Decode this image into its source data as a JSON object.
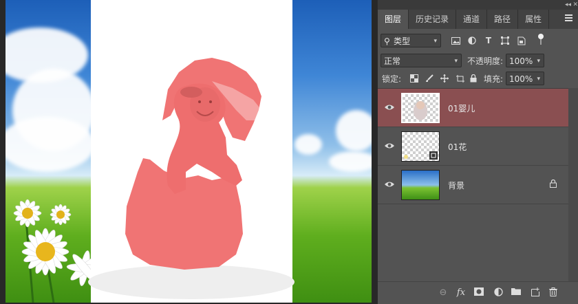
{
  "panel": {
    "tabs": [
      {
        "label": "图层",
        "active": true
      },
      {
        "label": "历史记录"
      },
      {
        "label": "通道"
      },
      {
        "label": "路径"
      },
      {
        "label": "属性"
      }
    ],
    "filter_kind": "类型",
    "blend_mode": "正常",
    "opacity_label": "不透明度:",
    "opacity_value": "100%",
    "lock_label": "锁定:",
    "fill_label": "填充:",
    "fill_value": "100%",
    "layers": [
      {
        "name": "01婴儿",
        "selected": true,
        "icon": "baby-thumbnail"
      },
      {
        "name": "01花",
        "selected": false,
        "icon": "flower-thumbnail"
      },
      {
        "name": "背景",
        "selected": false,
        "locked": true,
        "icon": "landscape-thumbnail"
      }
    ],
    "collapse_glyph": "◂◂",
    "close_glyph": "✕"
  },
  "colors": {
    "panel_bg": "#535353",
    "selected_layer": "#8a4f51",
    "mask_overlay": "#f07474"
  }
}
